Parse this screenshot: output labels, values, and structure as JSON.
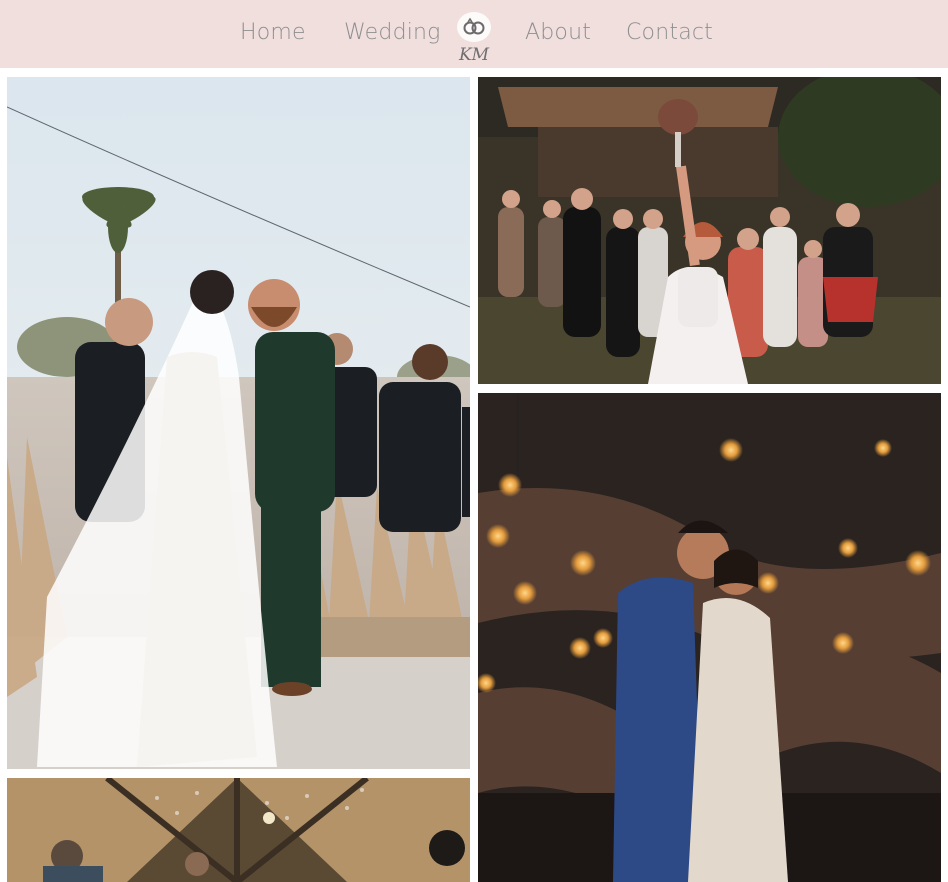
{
  "nav": {
    "links": [
      {
        "label": "Home"
      },
      {
        "label": "Wedding"
      },
      {
        "label": "About"
      },
      {
        "label": "Contact"
      }
    ],
    "logo": {
      "monogram": "KM",
      "icon": "interlocked-rings-icon"
    }
  },
  "gallery": {
    "photos": [
      {
        "subject": "outdoor-wedding-ceremony"
      },
      {
        "subject": "bride-tossing-bouquet"
      },
      {
        "subject": "couple-under-edison-bulbs"
      },
      {
        "subject": "confetti-under-wooden-roof"
      }
    ]
  },
  "colors": {
    "nav_background": "#f1dfde",
    "nav_text": "#8e8e8e",
    "page_background": "#ffffff"
  }
}
